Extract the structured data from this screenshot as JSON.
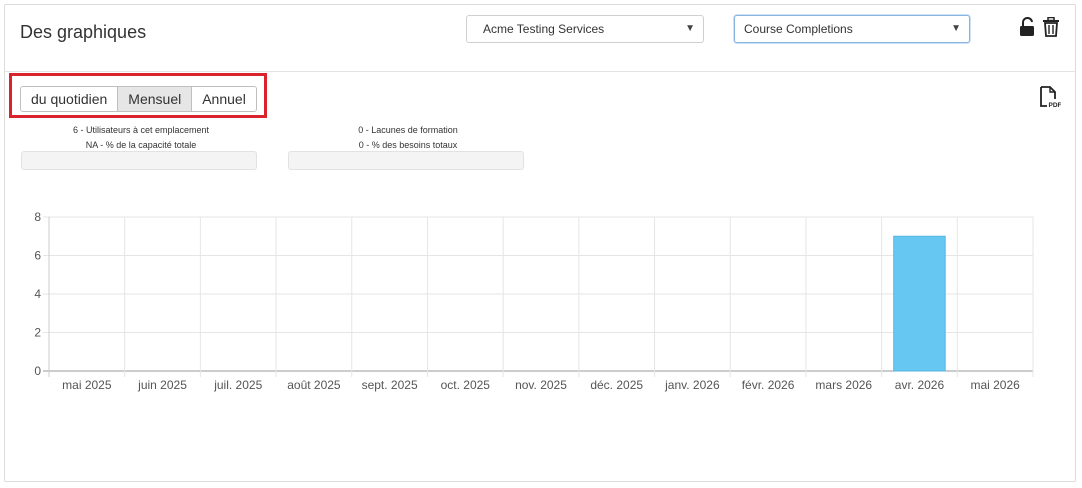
{
  "header": {
    "title": "Des graphiques",
    "location_select": "Acme Testing Services",
    "report_select": "Course Completions"
  },
  "icons": {
    "lock": "unlock-icon",
    "trash": "trash-icon",
    "pdf": "pdf-icon"
  },
  "period_buttons": [
    {
      "label": "du quotidien",
      "active": false
    },
    {
      "label": "Mensuel",
      "active": true
    },
    {
      "label": "Annuel",
      "active": false
    }
  ],
  "stats": {
    "users_line": "6 - Utilisateurs à cet emplacement",
    "capacity_line": "NA - % de la capacité totale",
    "gaps_line": "0 - Lacunes de formation",
    "needs_line": "0 - % des besoins totaux"
  },
  "colors": {
    "bar": "#66c8f2",
    "highlight": "#d9232d"
  },
  "chart_data": {
    "type": "bar",
    "categories": [
      "mai 2025",
      "juin 2025",
      "juil. 2025",
      "août 2025",
      "sept. 2025",
      "oct. 2025",
      "nov. 2025",
      "déc. 2025",
      "janv. 2026",
      "févr. 2026",
      "mars 2026",
      "avr. 2026",
      "mai 2026"
    ],
    "values": [
      0,
      0,
      0,
      0,
      0,
      0,
      0,
      0,
      0,
      0,
      0,
      7,
      0
    ],
    "yticks": [
      "0",
      "2",
      "4",
      "6",
      "8"
    ],
    "ylim": [
      0,
      8
    ],
    "grid": true
  }
}
